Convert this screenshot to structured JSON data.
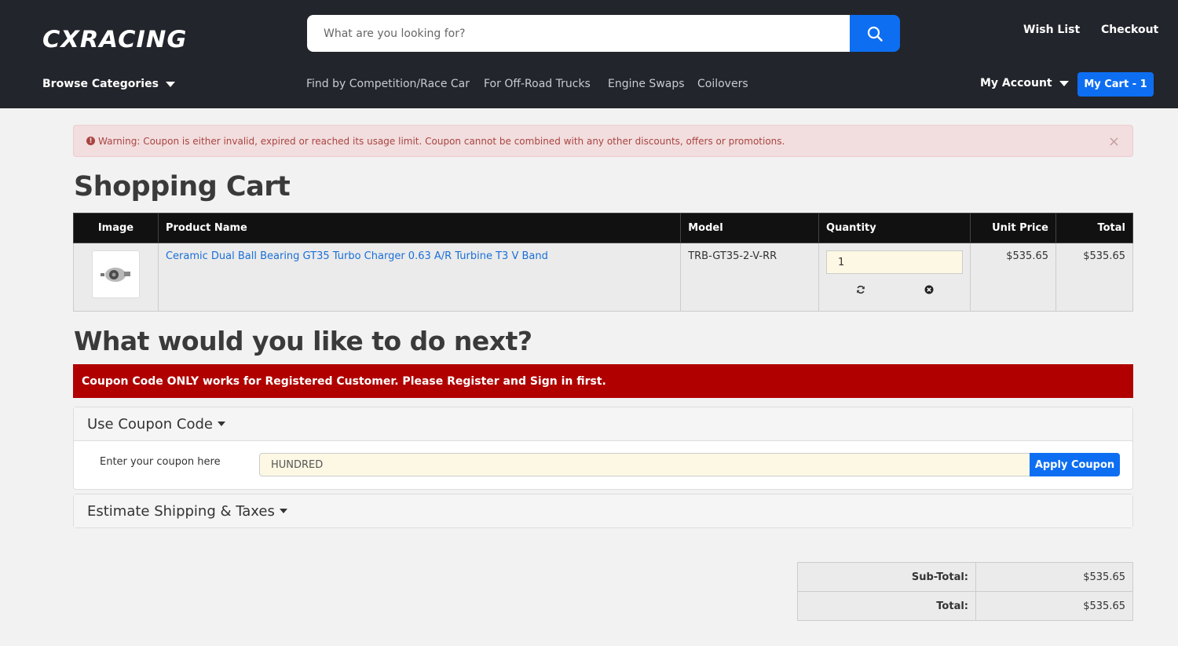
{
  "brand": {
    "logo_text": "CXRACING"
  },
  "search": {
    "placeholder": "What are you looking for?"
  },
  "header": {
    "wish_list": "Wish List",
    "checkout": "Checkout",
    "browse_categories": "Browse Categories",
    "nav": [
      "Find by Competition/Race Car",
      "For Off-Road Trucks",
      "Engine Swaps",
      "Coilovers"
    ],
    "my_account": "My Account",
    "my_cart": "My Cart - 1"
  },
  "alert": {
    "message": "Warning: Coupon is either invalid, expired or reached its usage limit. Coupon cannot be combined with any other discounts, offers or promotions.",
    "close": "×"
  },
  "cart": {
    "title": "Shopping Cart",
    "columns": [
      "Image",
      "Product Name",
      "Model",
      "Quantity",
      "Unit Price",
      "Total"
    ],
    "item": {
      "name": "Ceramic Dual Ball Bearing GT35 Turbo Charger 0.63 A/R Turbine T3 V Band",
      "model": "TRB-GT35-2-V-RR",
      "quantity": "1",
      "unit_price": "$535.65",
      "total": "$535.65"
    }
  },
  "next": {
    "title": "What would you like to do next?",
    "banner": "Coupon Code ONLY works for Registered Customer. Please Register and Sign in first.",
    "coupon_panel": {
      "heading": "Use Coupon Code",
      "label": "Enter your coupon here",
      "value": "HUNDRED",
      "apply": "Apply Coupon"
    },
    "shipping_panel": {
      "heading": "Estimate Shipping & Taxes"
    }
  },
  "totals": {
    "subtotal_label": "Sub-Total:",
    "subtotal": "$535.65",
    "total_label": "Total:",
    "total": "$535.65"
  },
  "colors": {
    "accent": "#0d6ef2",
    "header_bg": "#22252b",
    "banner_red": "#b00000"
  }
}
